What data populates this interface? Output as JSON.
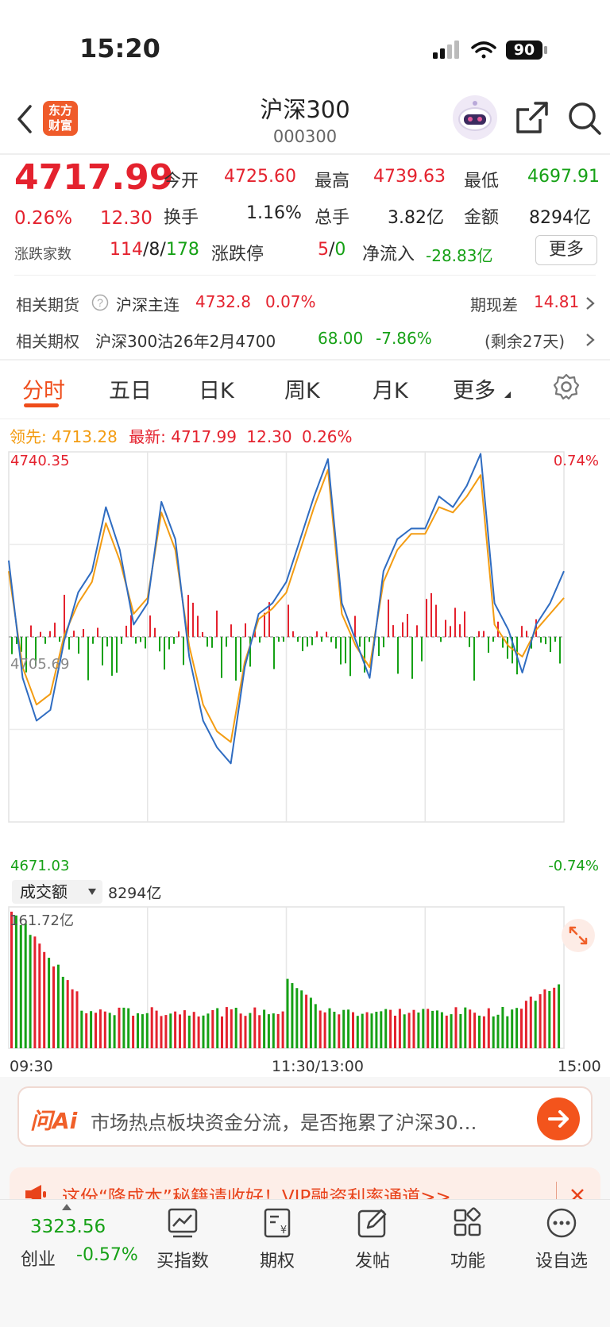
{
  "status_bar": {
    "time": "15:20",
    "battery": "90"
  },
  "header": {
    "logo_line1": "东方",
    "logo_line2": "财富",
    "title": "沪深300",
    "code": "000300"
  },
  "quote": {
    "price": "4717.99",
    "change_pct": "0.26%",
    "change": "12.30",
    "rows": [
      [
        {
          "label": "今开",
          "value": "4725.60"
        },
        {
          "label": "最高",
          "value": "4739.63"
        },
        {
          "label": "最低",
          "value": "4697.91"
        }
      ],
      [
        {
          "label": "换手",
          "value": "1.16%"
        },
        {
          "label": "总手",
          "value": "3.82亿"
        },
        {
          "label": "金额",
          "value": "8294亿"
        }
      ]
    ],
    "breadth_label": "涨跌家数",
    "breadth_up": "114",
    "breadth_sep1": "/",
    "breadth_flat": "8",
    "breadth_sep2": "/",
    "breadth_down": "178",
    "limit_label": "涨跌停",
    "limit_up": "5",
    "limit_sep": "/",
    "limit_down": "0",
    "netflow_label": "净流入",
    "netflow_value": "-28.83亿",
    "more_button": "更多"
  },
  "related": {
    "futures_label": "相关期货",
    "futures_name": "沪深主连",
    "futures_price": "4732.8",
    "futures_pct": "0.07%",
    "basis_label": "期现差",
    "basis_value": "14.81",
    "options_label": "相关期权",
    "options_name": "沪深300沽26年2月4700",
    "options_price": "68.00",
    "options_pct": "-7.86%",
    "options_remaining": "(剩余27天)"
  },
  "tabs": [
    "分时",
    "五日",
    "日K",
    "周K",
    "月K",
    "更多"
  ],
  "active_tab": "分时",
  "chart_legend": {
    "lead_label": "领先:",
    "lead_value": "4713.28",
    "latest_label": "最新:",
    "latest_value": "4717.99",
    "latest_change": "12.30",
    "latest_pct": "0.26%"
  },
  "price_axis": {
    "top": "4740.35",
    "mid": "4705.69",
    "bottom": "4671.03",
    "top_pct": "0.74%",
    "bottom_pct": "-0.74%"
  },
  "volume": {
    "selector": "成交额",
    "total": "8294亿",
    "max_label": "161.72亿"
  },
  "time_axis": [
    "09:30",
    "11:30/13:00",
    "15:00"
  ],
  "ai_bar": {
    "logo": "问Ai",
    "prompt": "市场热点板块资金分流，是否拖累了沪深30…"
  },
  "promo": {
    "text": "这份“降成本”秘籍请收好！VIP融资利率通道>>"
  },
  "bottom_bar": {
    "index_value": "3323.56",
    "index_name": "创业",
    "index_pct": "-0.57%",
    "items": [
      "买指数",
      "期权",
      "发帖",
      "功能",
      "设自选"
    ]
  },
  "colors": {
    "up": "#e4222e",
    "down": "#16a116",
    "lead_line": "#f39c12",
    "price_line": "#2f6cc1",
    "accent": "#ef4d1b"
  },
  "chart_data": {
    "type": "line",
    "x": [
      "09:30",
      "10:00",
      "10:30",
      "11:00",
      "11:30/13:00",
      "13:30",
      "14:00",
      "14:30",
      "15:00"
    ],
    "ylim": [
      4671.03,
      4740.35
    ],
    "series": [
      {
        "name": "最新",
        "values": [
          4720,
          4698,
          4690,
          4692,
          4705,
          4714,
          4718,
          4730,
          4722,
          4708,
          4712,
          4731,
          4724,
          4702,
          4690,
          4685,
          4682,
          4700,
          4710,
          4712,
          4716,
          4724,
          4732,
          4739,
          4712,
          4705,
          4698,
          4718,
          4724,
          4726,
          4726,
          4732,
          4730,
          4734,
          4740,
          4712,
          4707,
          4699,
          4708,
          4712,
          4718
        ]
      },
      {
        "name": "领先",
        "values": [
          4718,
          4700,
          4693,
          4695,
          4706,
          4712,
          4716,
          4727,
          4720,
          4710,
          4713,
          4729,
          4722,
          4704,
          4693,
          4688,
          4686,
          4701,
          4709,
          4711,
          4714,
          4722,
          4730,
          4737,
          4710,
          4704,
          4700,
          4716,
          4722,
          4725,
          4725,
          4730,
          4729,
          4732,
          4736,
          4708,
          4704,
          4702,
          4707,
          4710,
          4713
        ]
      }
    ]
  }
}
